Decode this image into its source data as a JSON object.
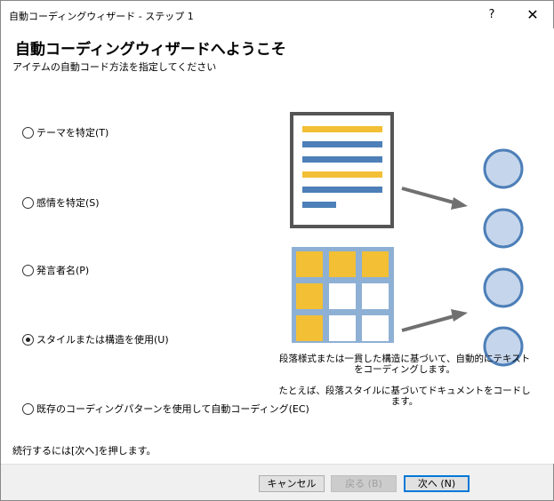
{
  "window": {
    "title": "自動コーディングウィザード - ステップ 1",
    "help": "?",
    "close": "✕"
  },
  "header": {
    "title": "自動コーディングウィザードへようこそ",
    "subtitle": "アイテムの自動コード方法を指定してください"
  },
  "options": [
    {
      "label": "テーマを特定(T)",
      "checked": false
    },
    {
      "label": "感情を特定(S)",
      "checked": false
    },
    {
      "label": "発言者名(P)",
      "checked": false
    },
    {
      "label": "スタイルまたは構造を使用(U)",
      "checked": true
    },
    {
      "label": "既存のコーディングパターンを使用して自動コーディング(EC)",
      "checked": false
    }
  ],
  "illustration": {
    "colors": {
      "border": "#555555",
      "bar_yellow": "#f2bf35",
      "bar_blue": "#4d7fb8",
      "grid": "#8eb0d4",
      "circle_fill": "#c5d5eb",
      "circle_stroke": "#4d7fb8",
      "arrow": "#707070"
    }
  },
  "description": {
    "line1": "段落様式または一貫した構造に基づいて、自動的にテキストをコーディングします。",
    "line2": "たとえば、段落スタイルに基づいてドキュメントをコードします。"
  },
  "footer": {
    "instruction": "続行するには[次へ]を押します。"
  },
  "buttons": {
    "cancel": "キャンセル",
    "back": "戻る (B)",
    "next": "次へ (N)"
  }
}
